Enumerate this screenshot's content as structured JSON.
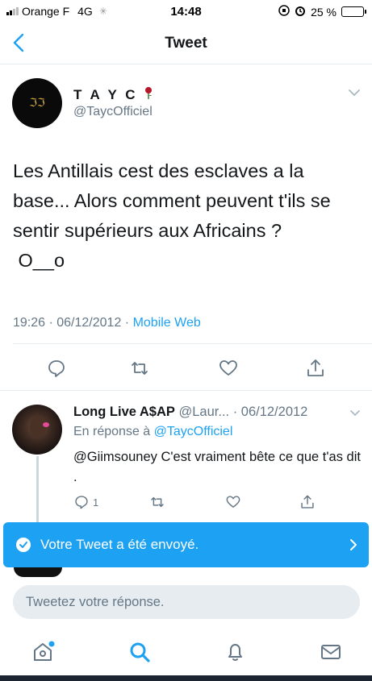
{
  "status_bar": {
    "carrier": "Orange F",
    "network": "4G",
    "time": "14:48",
    "battery_percent": "25 %",
    "battery_level": 0.25
  },
  "navbar": {
    "title": "Tweet",
    "back_icon": "chevron-left-icon"
  },
  "tweet": {
    "display_name": "T A Y C",
    "handle": "@TaycOfficiel",
    "text": "Les Antillais cest des esclaves a la base... Alors comment peuvent t'ils se sentir supérieurs aux Africains ?\n O__o",
    "time": "19:26 · 06/12/2012 · ",
    "source": "Mobile Web",
    "actions": [
      "reply-icon",
      "retweet-icon",
      "like-icon",
      "share-icon"
    ]
  },
  "reply": {
    "display_name": "Long Live A$AP",
    "handle_date": " @Laur... · 06/12/2012",
    "reply_to_prefix": "En réponse à ",
    "reply_to_handle": "@TaycOfficiel",
    "text": "@Giimsouney C'est vraiment bête ce que t'as dit .",
    "reply_count": "1"
  },
  "toast": {
    "message": "Votre Tweet a été envoyé."
  },
  "compose": {
    "placeholder": "Tweetez votre réponse."
  },
  "tabbar": {
    "tabs": [
      "home-icon",
      "search-icon",
      "notifications-icon",
      "messages-icon"
    ]
  },
  "colors": {
    "accent": "#1da1f2",
    "secondary_text": "#657786"
  }
}
